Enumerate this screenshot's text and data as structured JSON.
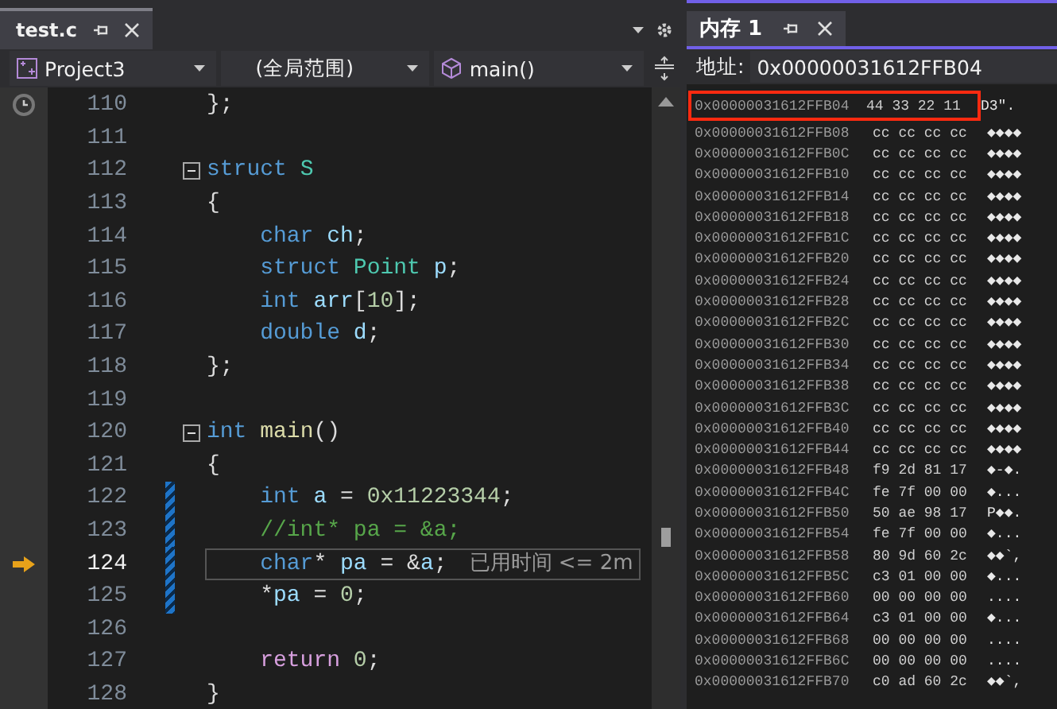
{
  "editor": {
    "tab": {
      "title": "test.c",
      "selected": true
    },
    "nav": {
      "project": "Project3",
      "scope": "(全局范围)",
      "function": "main()"
    },
    "lines": [
      {
        "number": "110",
        "fold": false,
        "changed": false,
        "current": false,
        "tokens": [
          {
            "kind": "plain",
            "text": "};"
          }
        ]
      },
      {
        "number": "111",
        "fold": false,
        "changed": false,
        "current": false
      },
      {
        "number": "112",
        "fold": true,
        "changed": false,
        "current": false,
        "tokens": [
          {
            "kind": "keyword",
            "text": "struct "
          },
          {
            "kind": "type",
            "text": "S"
          }
        ]
      },
      {
        "number": "113",
        "fold": false,
        "changed": false,
        "current": false,
        "tokens": [
          {
            "kind": "plain",
            "text": "{"
          }
        ]
      },
      {
        "number": "114",
        "fold": false,
        "changed": false,
        "current": false,
        "tokens": [
          {
            "kind": "keyword",
            "text": "    char "
          },
          {
            "kind": "variable",
            "text": "ch"
          },
          {
            "kind": "plain",
            "text": ";"
          }
        ]
      },
      {
        "number": "115",
        "fold": false,
        "changed": false,
        "current": false,
        "tokens": [
          {
            "kind": "keyword",
            "text": "    struct "
          },
          {
            "kind": "type",
            "text": "Point "
          },
          {
            "kind": "variable",
            "text": "p"
          },
          {
            "kind": "plain",
            "text": ";"
          }
        ]
      },
      {
        "number": "116",
        "fold": false,
        "changed": false,
        "current": false,
        "tokens": [
          {
            "kind": "keyword",
            "text": "    int "
          },
          {
            "kind": "variable",
            "text": "arr"
          },
          {
            "kind": "plain",
            "text": "["
          },
          {
            "kind": "number",
            "text": "10"
          },
          {
            "kind": "plain",
            "text": "];"
          }
        ]
      },
      {
        "number": "117",
        "fold": false,
        "changed": false,
        "current": false,
        "tokens": [
          {
            "kind": "keyword",
            "text": "    double "
          },
          {
            "kind": "variable",
            "text": "d"
          },
          {
            "kind": "plain",
            "text": ";"
          }
        ]
      },
      {
        "number": "118",
        "fold": false,
        "changed": false,
        "current": false,
        "tokens": [
          {
            "kind": "plain",
            "text": "};"
          }
        ]
      },
      {
        "number": "119",
        "fold": false,
        "changed": false,
        "current": false
      },
      {
        "number": "120",
        "fold": true,
        "changed": false,
        "current": false,
        "tokens": [
          {
            "kind": "keyword",
            "text": "int "
          },
          {
            "kind": "function",
            "text": "main"
          },
          {
            "kind": "plain",
            "text": "()"
          }
        ]
      },
      {
        "number": "121",
        "fold": false,
        "changed": false,
        "current": false,
        "tokens": [
          {
            "kind": "plain",
            "text": "{"
          }
        ]
      },
      {
        "number": "122",
        "fold": false,
        "changed": true,
        "current": false,
        "tokens": [
          {
            "kind": "keyword",
            "text": "    int "
          },
          {
            "kind": "variable",
            "text": "a"
          },
          {
            "kind": "plain",
            "text": " = "
          },
          {
            "kind": "number",
            "text": "0x11223344"
          },
          {
            "kind": "plain",
            "text": ";"
          }
        ]
      },
      {
        "number": "123",
        "fold": false,
        "changed": true,
        "current": false,
        "tokens": [
          {
            "kind": "comment",
            "text": "    //int* pa = &a;"
          }
        ]
      },
      {
        "number": "124",
        "fold": false,
        "changed": true,
        "current": true,
        "hint": "已用时间 <= 2m",
        "tokens": [
          {
            "kind": "keyword",
            "text": "    char"
          },
          {
            "kind": "plain",
            "text": "* "
          },
          {
            "kind": "variable",
            "text": "pa"
          },
          {
            "kind": "plain",
            "text": " = &"
          },
          {
            "kind": "variable",
            "text": "a"
          },
          {
            "kind": "plain",
            "text": ";"
          }
        ]
      },
      {
        "number": "125",
        "fold": false,
        "changed": true,
        "current": false,
        "tokens": [
          {
            "kind": "plain",
            "text": "    *"
          },
          {
            "kind": "variable",
            "text": "pa"
          },
          {
            "kind": "plain",
            "text": " = "
          },
          {
            "kind": "number",
            "text": "0"
          },
          {
            "kind": "plain",
            "text": ";"
          }
        ]
      },
      {
        "number": "126",
        "fold": false,
        "changed": false,
        "current": false
      },
      {
        "number": "127",
        "fold": false,
        "changed": false,
        "current": false,
        "tokens": [
          {
            "kind": "control",
            "text": "    return "
          },
          {
            "kind": "number",
            "text": "0"
          },
          {
            "kind": "plain",
            "text": ";"
          }
        ]
      },
      {
        "number": "128",
        "fold": false,
        "changed": false,
        "current": false,
        "tokens": [
          {
            "kind": "plain",
            "text": "}"
          }
        ]
      }
    ]
  },
  "memory": {
    "tab": {
      "title": "内存 1",
      "selected": true
    },
    "address_label": "地址:",
    "address": "0x00000031612FFB04",
    "rows": [
      {
        "address": "0x00000031612FFB04",
        "bytes": "44 33 22 11",
        "ascii": "D3\".",
        "highlighted": true
      },
      {
        "address": "0x00000031612FFB08",
        "bytes": "cc cc cc cc",
        "ascii": "◆◆◆◆",
        "highlighted": false
      },
      {
        "address": "0x00000031612FFB0C",
        "bytes": "cc cc cc cc",
        "ascii": "◆◆◆◆",
        "highlighted": false
      },
      {
        "address": "0x00000031612FFB10",
        "bytes": "cc cc cc cc",
        "ascii": "◆◆◆◆",
        "highlighted": false
      },
      {
        "address": "0x00000031612FFB14",
        "bytes": "cc cc cc cc",
        "ascii": "◆◆◆◆",
        "highlighted": false
      },
      {
        "address": "0x00000031612FFB18",
        "bytes": "cc cc cc cc",
        "ascii": "◆◆◆◆",
        "highlighted": false
      },
      {
        "address": "0x00000031612FFB1C",
        "bytes": "cc cc cc cc",
        "ascii": "◆◆◆◆",
        "highlighted": false
      },
      {
        "address": "0x00000031612FFB20",
        "bytes": "cc cc cc cc",
        "ascii": "◆◆◆◆",
        "highlighted": false
      },
      {
        "address": "0x00000031612FFB24",
        "bytes": "cc cc cc cc",
        "ascii": "◆◆◆◆",
        "highlighted": false
      },
      {
        "address": "0x00000031612FFB28",
        "bytes": "cc cc cc cc",
        "ascii": "◆◆◆◆",
        "highlighted": false
      },
      {
        "address": "0x00000031612FFB2C",
        "bytes": "cc cc cc cc",
        "ascii": "◆◆◆◆",
        "highlighted": false
      },
      {
        "address": "0x00000031612FFB30",
        "bytes": "cc cc cc cc",
        "ascii": "◆◆◆◆",
        "highlighted": false
      },
      {
        "address": "0x00000031612FFB34",
        "bytes": "cc cc cc cc",
        "ascii": "◆◆◆◆",
        "highlighted": false
      },
      {
        "address": "0x00000031612FFB38",
        "bytes": "cc cc cc cc",
        "ascii": "◆◆◆◆",
        "highlighted": false
      },
      {
        "address": "0x00000031612FFB3C",
        "bytes": "cc cc cc cc",
        "ascii": "◆◆◆◆",
        "highlighted": false
      },
      {
        "address": "0x00000031612FFB40",
        "bytes": "cc cc cc cc",
        "ascii": "◆◆◆◆",
        "highlighted": false
      },
      {
        "address": "0x00000031612FFB44",
        "bytes": "cc cc cc cc",
        "ascii": "◆◆◆◆",
        "highlighted": false
      },
      {
        "address": "0x00000031612FFB48",
        "bytes": "f9 2d 81 17",
        "ascii": "◆-◆.",
        "highlighted": false
      },
      {
        "address": "0x00000031612FFB4C",
        "bytes": "fe 7f 00 00",
        "ascii": "◆...",
        "highlighted": false
      },
      {
        "address": "0x00000031612FFB50",
        "bytes": "50 ae 98 17",
        "ascii": "P◆◆.",
        "highlighted": false
      },
      {
        "address": "0x00000031612FFB54",
        "bytes": "fe 7f 00 00",
        "ascii": "◆...",
        "highlighted": false
      },
      {
        "address": "0x00000031612FFB58",
        "bytes": "80 9d 60 2c",
        "ascii": "◆◆`,",
        "highlighted": false
      },
      {
        "address": "0x00000031612FFB5C",
        "bytes": "c3 01 00 00",
        "ascii": "◆...",
        "highlighted": false
      },
      {
        "address": "0x00000031612FFB60",
        "bytes": "00 00 00 00",
        "ascii": "....",
        "highlighted": false
      },
      {
        "address": "0x00000031612FFB64",
        "bytes": "c3 01 00 00",
        "ascii": "◆...",
        "highlighted": false
      },
      {
        "address": "0x00000031612FFB68",
        "bytes": "00 00 00 00",
        "ascii": "....",
        "highlighted": false
      },
      {
        "address": "0x00000031612FFB6C",
        "bytes": "00 00 00 00",
        "ascii": "....",
        "highlighted": false
      },
      {
        "address": "0x00000031612FFB70",
        "bytes": "c0 ad 60 2c",
        "ascii": "◆◆`,",
        "highlighted": false
      }
    ]
  }
}
